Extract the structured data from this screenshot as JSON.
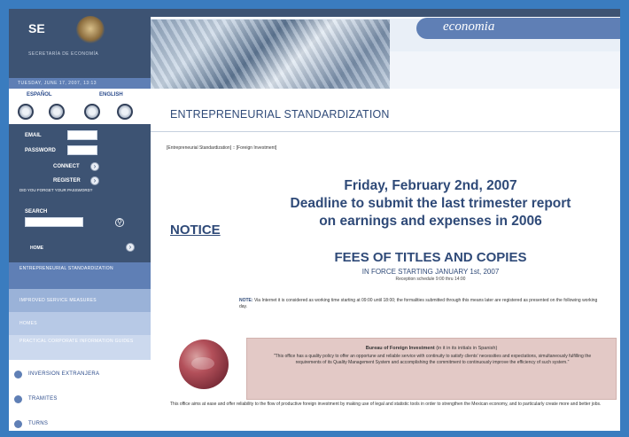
{
  "header": {
    "logo_text": "SE",
    "logo_subtitle": "SECRETARÍA DE ECONOMÍA",
    "brand": "economia",
    "date": "TUESDAY, JUNE 17, 2007, 13:13"
  },
  "languages": {
    "spanish": "ESPAÑOL",
    "english": "ENGLISH"
  },
  "login": {
    "email_label": "EMAIL",
    "password_label": "PASSWORD",
    "connect_label": "CONNECT",
    "register_label": "REGISTER",
    "forgot_label": "DID YOU FORGET YOUR PASSWORD?",
    "search_label": "SEARCH",
    "home_label": "HOME"
  },
  "nav": [
    "ENTREPRENEURIAL STANDARDIZATION",
    "IMPROVED SERVICE MEASURES",
    "HOMES",
    "PRACTICAL CORPORATE INFORMATION GUIDES"
  ],
  "subnav": [
    "INVERSION EXTRANJERA",
    "TRAMITES",
    "TURNS"
  ],
  "main": {
    "page_title": "ENTREPRENEURIAL STANDARDIZATION",
    "breadcrumb": "[Entrepreneurial Standardization]  ::  [Foreign Investment]",
    "notice_label": "NOTICE",
    "headline_date": "Friday, February 2nd, 2007",
    "headline_line2": "Deadline to submit the last trimester report",
    "headline_line3": "on earnings and expenses in 2006",
    "fees_title": "FEES OF TITLES AND COPIES",
    "in_force": "IN FORCE STARTING JANUARY 1st, 2007",
    "schedule": "Reception schedule 9:00 thru 14:00",
    "note_label": "NOTE:",
    "note_text": "Via Internet it is considered as working time starting at 09:00 until 18:00; the formalities submitted through this means later are registered as presented on the following working day.",
    "bureau_title": "Bureau of Foreign Investment",
    "bureau_title_small": "(in it in its initials in Spanish)",
    "bureau_text": "\"This office has a quality policy to offer an opportune and reliable service with continuity to satisfy clients' necessities and expectations, simultaneously fulfilling the requirements of its Quality Management System and accomplishing the commitment to continuously improve the efficiency of such system.\"",
    "footer_text": "This office aims at ease and offer reliability to the flow of productive foreign investment by making use of legal and statistic tools in order to strengthen the Mexican economy, and to particularly create more and better jobs."
  },
  "colors": {
    "navy": "#3d5373",
    "accent": "#5f7fb5",
    "title": "#2f4a78",
    "bureau_bg": "#e3c9c6",
    "frame": "#3a7cbf"
  }
}
